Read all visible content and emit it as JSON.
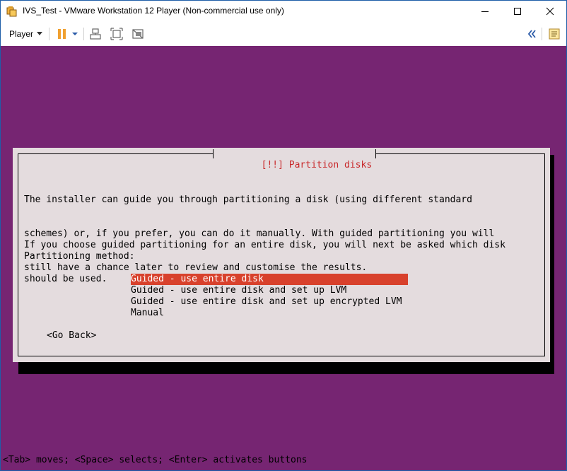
{
  "window": {
    "title": "IVS_Test - VMware Workstation 12 Player (Non-commercial use only)",
    "controls": {
      "minimize_icon": "minimize-icon",
      "maximize_icon": "maximize-icon",
      "close_icon": "close-icon"
    }
  },
  "toolbar": {
    "player_label": "Player",
    "buttons": [
      "pause-icon",
      "dropdown-arrow-icon",
      "send-ctrl-alt-del-icon",
      "fit-guest-icon",
      "unity-icon",
      "collapse-panel-icon",
      "message-log-icon"
    ],
    "accent": "#f0a030"
  },
  "installer": {
    "background": "#762572",
    "dialog_title": "[!!] Partition disks",
    "paragraph1": [
      "The installer can guide you through partitioning a disk (using different standard",
      "schemes) or, if you prefer, you can do it manually. With guided partitioning you will",
      "still have a chance later to review and customise the results."
    ],
    "paragraph2": [
      "If you choose guided partitioning for an entire disk, you will next be asked which disk",
      "should be used."
    ],
    "method_label": "Partitioning method:",
    "options": [
      "Guided - use entire disk",
      "Guided - use entire disk and set up LVM",
      "Guided - use entire disk and set up encrypted LVM",
      "Manual"
    ],
    "selected_index": 0,
    "selection_color": "#d8412c",
    "go_back": "<Go Back>",
    "status_line": "<Tab> moves; <Space> selects; <Enter> activates buttons"
  }
}
